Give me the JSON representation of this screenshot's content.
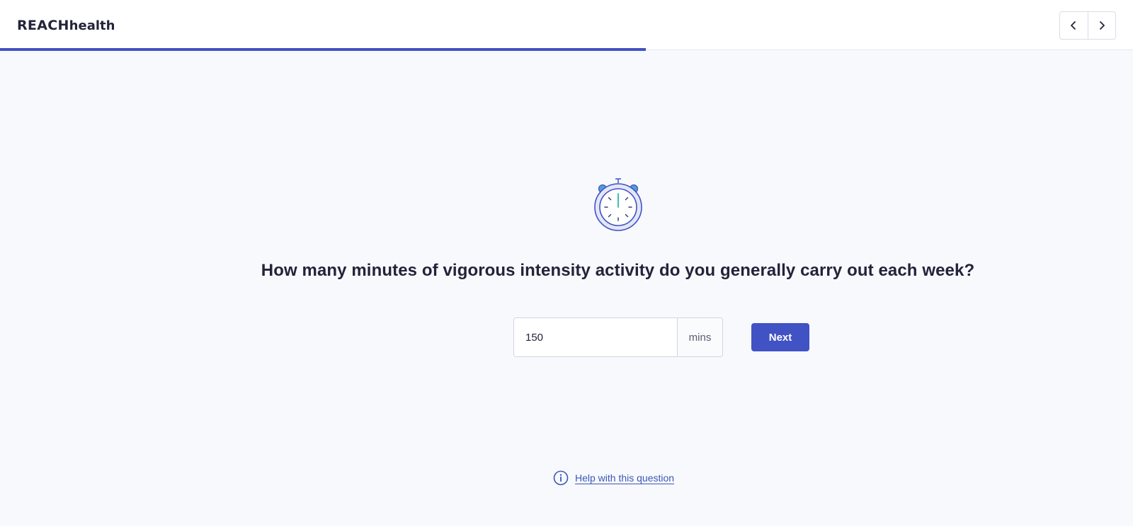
{
  "header": {
    "logo_reach": "REACH",
    "logo_health": "health",
    "progress_percent": 57,
    "back_icon": "chevron-left-icon",
    "forward_icon": "chevron-right-icon"
  },
  "question": {
    "icon": "stopwatch-icon",
    "text": "How many minutes of vigorous intensity activity do you generally carry out each week?",
    "answer_value": "150",
    "unit": "mins",
    "next_label": "Next"
  },
  "help": {
    "icon": "info-icon",
    "label": "Help with this question"
  },
  "colors": {
    "accent": "#4152c4",
    "link": "#3a57b8",
    "text": "#23233a",
    "background": "#f8f9fd"
  }
}
